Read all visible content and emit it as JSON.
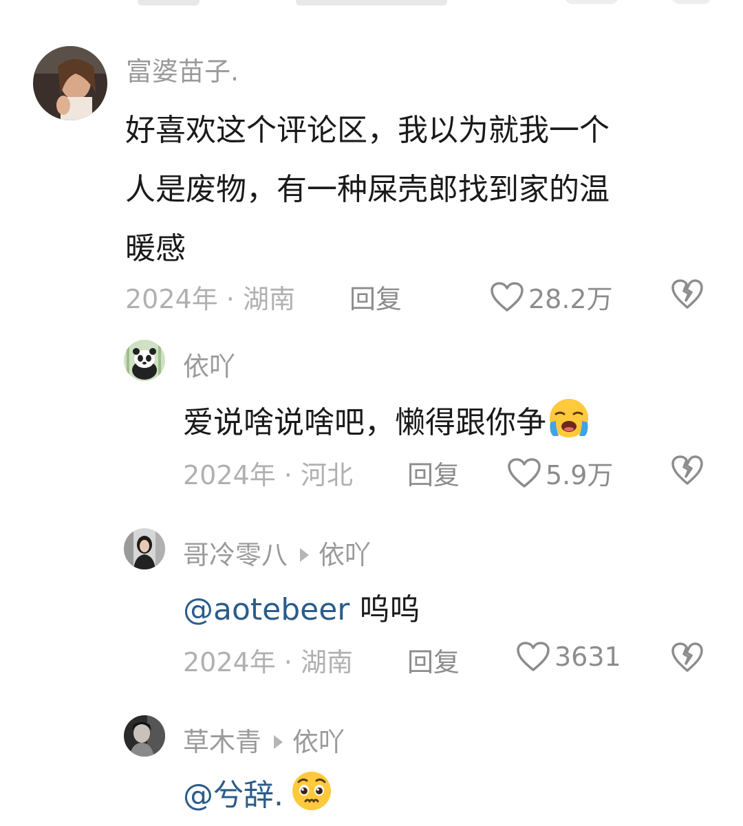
{
  "comments": [
    {
      "username": "富婆苗子.",
      "text_line1": "好喜欢这个评论区，我以为就我一个",
      "text_line2": "人是废物，有一种屎壳郎找到家的温",
      "text_line3": "暖感",
      "meta": "2024年 · 湖南",
      "reply_label": "回复",
      "likes": "28.2万",
      "avatar_icon": "avatar-woman-photo"
    },
    {
      "username": "依吖",
      "text": "爱说啥说啥吧，懒得跟你争",
      "emoji": "loudly-crying-face",
      "meta": "2024年 · 河北",
      "reply_label": "回复",
      "likes": "5.9万",
      "avatar_icon": "avatar-panda"
    },
    {
      "username": "哥冷零八",
      "reply_to": "依吖",
      "mention": "@aotebeer",
      "text": " 呜呜",
      "meta": "2024年 · 湖南",
      "reply_label": "回复",
      "likes": "3631",
      "avatar_icon": "avatar-girl-dark"
    },
    {
      "username": "草木青",
      "reply_to": "依吖",
      "mention": "@兮辞.",
      "emoji": "pleading-face",
      "avatar_icon": "avatar-person-bw"
    }
  ],
  "colors": {
    "username": "#9a9a9a",
    "mention": "#2b5c8a",
    "meta": "#b0b0b0",
    "action": "#8c8c8c"
  }
}
